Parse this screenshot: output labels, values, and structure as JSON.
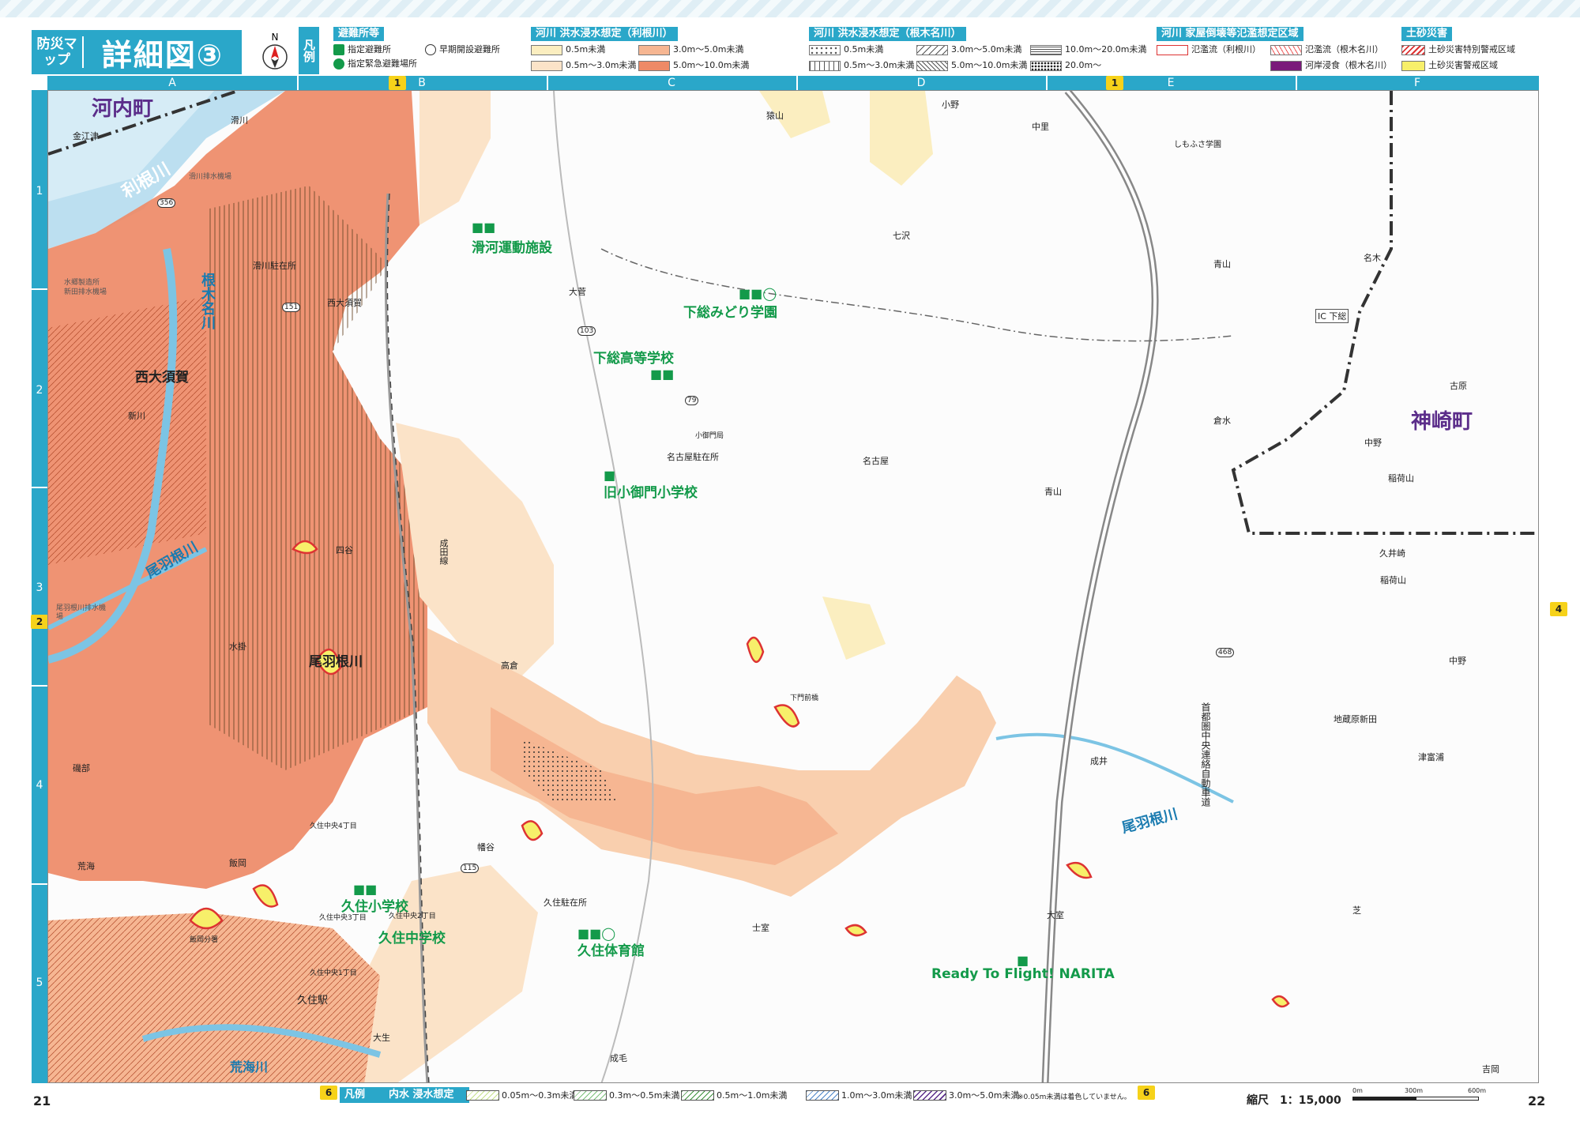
{
  "header": {
    "title_sub": "防災マップ",
    "title_main": "詳細図③",
    "compass_letter": "N",
    "legend_label": "凡例"
  },
  "legend": {
    "shelter": {
      "heading": "避難所等",
      "designated_shelter": "指定避難所",
      "emergency_evacuation": "指定緊急避難場所",
      "early_open": "早期開設避難所"
    },
    "tone": {
      "heading": "河川 洪水浸水想定（利根川）",
      "items": [
        "0.5m未満",
        "3.0m～5.0m未満",
        "0.5m～3.0m未満",
        "5.0m～10.0m未満"
      ]
    },
    "nekina": {
      "heading": "河川 洪水浸水想定（根木名川）",
      "items": [
        "0.5m未満",
        "3.0m～5.0m未満",
        "10.0m～20.0m未満",
        "0.5m～3.0m未満",
        "5.0m～10.0m未満",
        "20.0m～"
      ]
    },
    "collapse": {
      "heading": "河川 家屋倒壊等氾濫想定区域",
      "items": [
        "氾濫流（利根川）",
        "氾濫流（根木名川）",
        "河岸浸食（根木名川）"
      ]
    },
    "landslide": {
      "heading": "土砂災害",
      "items": [
        "土砂災害特別警戒区域",
        "土砂災害警戒区域"
      ]
    },
    "colors": {
      "accent": "#2aa7c9",
      "flood_light": "#fbe3c8",
      "flood_mid": "#f6b692",
      "flood_deep": "#ee8a67",
      "flood_yellow": "#fbeec0",
      "shelter_green": "#139a4a",
      "town_purple": "#5b2d8a"
    }
  },
  "grid": {
    "columns": [
      "A",
      "B",
      "C",
      "D",
      "E",
      "F"
    ],
    "rows": [
      "1",
      "2",
      "3",
      "4",
      "5"
    ],
    "page_ref_markers": [
      "1",
      "1",
      "2",
      "4",
      "6",
      "6"
    ]
  },
  "map": {
    "towns": [
      "河内町",
      "神崎町"
    ],
    "rivers": [
      "利根川",
      "根木名川",
      "尾羽根川",
      "尾羽根川",
      "荒海川"
    ],
    "stations": [
      "西大須賀",
      "尾羽根川",
      "久住駅"
    ],
    "road_label": "首都圏中央連絡自動車道",
    "rail_label": "成田線",
    "interchange": "IC 下総",
    "route_numbers": [
      "356",
      "151",
      "103",
      "79",
      "115",
      "468"
    ],
    "facilities": [
      "滑河運動施設",
      "下総みどり学園",
      "下総高等学校",
      "旧小御門小学校",
      "久住小学校",
      "久住中学校",
      "久住体育館",
      "Ready To Flight! NARITA"
    ],
    "places": [
      "金江津",
      "滑川",
      "滑川駐在所",
      "西大須賀",
      "新川",
      "水掛",
      "四谷",
      "高倉",
      "磯部",
      "荒海",
      "飯岡",
      "久住中央4丁目",
      "久住中央3丁目",
      "久住中央2丁目",
      "久住中央1丁目",
      "飯岡分署",
      "大生",
      "幡谷",
      "久住駐在所",
      "成毛",
      "士室",
      "大室",
      "成井",
      "猿山",
      "大菅",
      "小御門局",
      "名古屋駐在所",
      "名古屋",
      "七沢",
      "小野",
      "中里",
      "しもふさ学園",
      "青山",
      "青山",
      "倉水",
      "名木",
      "古原",
      "中野",
      "稲荷山",
      "稲荷山",
      "久井崎",
      "中野",
      "地蔵原新田",
      "津富浦",
      "芝",
      "吉岡",
      "下門前橋"
    ],
    "small_labels": [
      "水郷製造所",
      "新田排水機場",
      "尾羽根川排水機場",
      "滑川排水機場"
    ]
  },
  "bottom_legend": {
    "label": "凡例",
    "heading": "内水 浸水想定",
    "items": [
      "0.05m～0.3m未満",
      "0.3m～0.5m未満",
      "0.5m～1.0m未満",
      "1.0m～3.0m未満",
      "3.0m～5.0m未満"
    ],
    "note": "※0.05m未満は着色していません。"
  },
  "footer": {
    "page_left": "21",
    "page_right": "22",
    "scale_text": "縮尺　1：15,000",
    "scale_ticks": [
      "0m",
      "300m",
      "600m"
    ]
  }
}
